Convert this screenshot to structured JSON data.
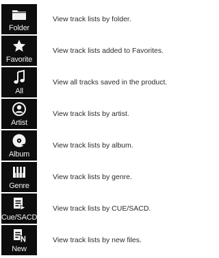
{
  "items": [
    {
      "icon": "folder-icon",
      "label": "Folder",
      "description": "View track lists by folder."
    },
    {
      "icon": "star-icon",
      "label": "Favorite",
      "description": "View track lists added to Favorites."
    },
    {
      "icon": "music-note-icon",
      "label": "All",
      "description": "View all tracks saved in the product."
    },
    {
      "icon": "artist-icon",
      "label": "Artist",
      "description": "View track lists by artist."
    },
    {
      "icon": "album-disc-icon",
      "label": "Album",
      "description": "View track lists by album."
    },
    {
      "icon": "piano-keys-icon",
      "label": "Genre",
      "description": "View track lists by genre."
    },
    {
      "icon": "cue-sacd-icon",
      "label": "Cue/SACD",
      "description": "View track lists by CUE/SACD."
    },
    {
      "icon": "new-files-icon",
      "label": "New",
      "description": "View track lists by new files."
    }
  ]
}
